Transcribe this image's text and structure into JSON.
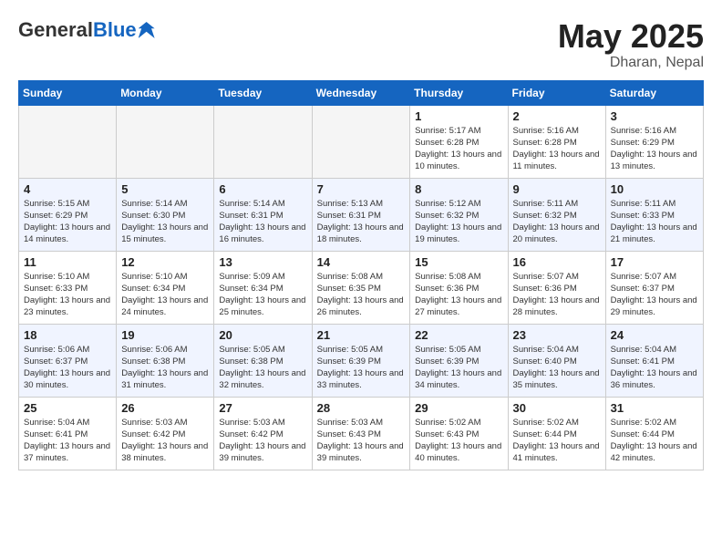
{
  "header": {
    "logo_general": "General",
    "logo_blue": "Blue",
    "month_year": "May 2025",
    "location": "Dharan, Nepal"
  },
  "days_of_week": [
    "Sunday",
    "Monday",
    "Tuesday",
    "Wednesday",
    "Thursday",
    "Friday",
    "Saturday"
  ],
  "weeks": [
    [
      {
        "day": "",
        "empty": true
      },
      {
        "day": "",
        "empty": true
      },
      {
        "day": "",
        "empty": true
      },
      {
        "day": "",
        "empty": true
      },
      {
        "day": "1",
        "sunrise": "5:17 AM",
        "sunset": "6:28 PM",
        "daylight": "13 hours and 10 minutes."
      },
      {
        "day": "2",
        "sunrise": "5:16 AM",
        "sunset": "6:28 PM",
        "daylight": "13 hours and 11 minutes."
      },
      {
        "day": "3",
        "sunrise": "5:16 AM",
        "sunset": "6:29 PM",
        "daylight": "13 hours and 13 minutes."
      }
    ],
    [
      {
        "day": "4",
        "sunrise": "5:15 AM",
        "sunset": "6:29 PM",
        "daylight": "13 hours and 14 minutes."
      },
      {
        "day": "5",
        "sunrise": "5:14 AM",
        "sunset": "6:30 PM",
        "daylight": "13 hours and 15 minutes."
      },
      {
        "day": "6",
        "sunrise": "5:14 AM",
        "sunset": "6:31 PM",
        "daylight": "13 hours and 16 minutes."
      },
      {
        "day": "7",
        "sunrise": "5:13 AM",
        "sunset": "6:31 PM",
        "daylight": "13 hours and 18 minutes."
      },
      {
        "day": "8",
        "sunrise": "5:12 AM",
        "sunset": "6:32 PM",
        "daylight": "13 hours and 19 minutes."
      },
      {
        "day": "9",
        "sunrise": "5:11 AM",
        "sunset": "6:32 PM",
        "daylight": "13 hours and 20 minutes."
      },
      {
        "day": "10",
        "sunrise": "5:11 AM",
        "sunset": "6:33 PM",
        "daylight": "13 hours and 21 minutes."
      }
    ],
    [
      {
        "day": "11",
        "sunrise": "5:10 AM",
        "sunset": "6:33 PM",
        "daylight": "13 hours and 23 minutes."
      },
      {
        "day": "12",
        "sunrise": "5:10 AM",
        "sunset": "6:34 PM",
        "daylight": "13 hours and 24 minutes."
      },
      {
        "day": "13",
        "sunrise": "5:09 AM",
        "sunset": "6:34 PM",
        "daylight": "13 hours and 25 minutes."
      },
      {
        "day": "14",
        "sunrise": "5:08 AM",
        "sunset": "6:35 PM",
        "daylight": "13 hours and 26 minutes."
      },
      {
        "day": "15",
        "sunrise": "5:08 AM",
        "sunset": "6:36 PM",
        "daylight": "13 hours and 27 minutes."
      },
      {
        "day": "16",
        "sunrise": "5:07 AM",
        "sunset": "6:36 PM",
        "daylight": "13 hours and 28 minutes."
      },
      {
        "day": "17",
        "sunrise": "5:07 AM",
        "sunset": "6:37 PM",
        "daylight": "13 hours and 29 minutes."
      }
    ],
    [
      {
        "day": "18",
        "sunrise": "5:06 AM",
        "sunset": "6:37 PM",
        "daylight": "13 hours and 30 minutes."
      },
      {
        "day": "19",
        "sunrise": "5:06 AM",
        "sunset": "6:38 PM",
        "daylight": "13 hours and 31 minutes."
      },
      {
        "day": "20",
        "sunrise": "5:05 AM",
        "sunset": "6:38 PM",
        "daylight": "13 hours and 32 minutes."
      },
      {
        "day": "21",
        "sunrise": "5:05 AM",
        "sunset": "6:39 PM",
        "daylight": "13 hours and 33 minutes."
      },
      {
        "day": "22",
        "sunrise": "5:05 AM",
        "sunset": "6:39 PM",
        "daylight": "13 hours and 34 minutes."
      },
      {
        "day": "23",
        "sunrise": "5:04 AM",
        "sunset": "6:40 PM",
        "daylight": "13 hours and 35 minutes."
      },
      {
        "day": "24",
        "sunrise": "5:04 AM",
        "sunset": "6:41 PM",
        "daylight": "13 hours and 36 minutes."
      }
    ],
    [
      {
        "day": "25",
        "sunrise": "5:04 AM",
        "sunset": "6:41 PM",
        "daylight": "13 hours and 37 minutes."
      },
      {
        "day": "26",
        "sunrise": "5:03 AM",
        "sunset": "6:42 PM",
        "daylight": "13 hours and 38 minutes."
      },
      {
        "day": "27",
        "sunrise": "5:03 AM",
        "sunset": "6:42 PM",
        "daylight": "13 hours and 39 minutes."
      },
      {
        "day": "28",
        "sunrise": "5:03 AM",
        "sunset": "6:43 PM",
        "daylight": "13 hours and 39 minutes."
      },
      {
        "day": "29",
        "sunrise": "5:02 AM",
        "sunset": "6:43 PM",
        "daylight": "13 hours and 40 minutes."
      },
      {
        "day": "30",
        "sunrise": "5:02 AM",
        "sunset": "6:44 PM",
        "daylight": "13 hours and 41 minutes."
      },
      {
        "day": "31",
        "sunrise": "5:02 AM",
        "sunset": "6:44 PM",
        "daylight": "13 hours and 42 minutes."
      }
    ]
  ],
  "labels": {
    "sunrise_prefix": "Sunrise: ",
    "sunset_prefix": "Sunset: ",
    "daylight_prefix": "Daylight: "
  }
}
